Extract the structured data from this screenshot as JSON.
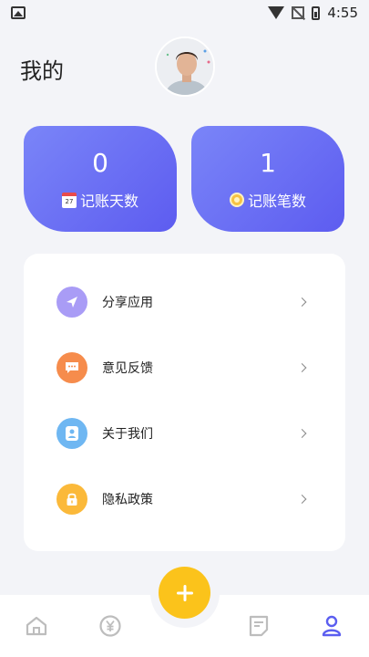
{
  "status_bar": {
    "time": "4:55",
    "icons": [
      "image-icon",
      "wifi-icon",
      "no-sim-icon",
      "battery-icon"
    ]
  },
  "header": {
    "title": "我的"
  },
  "stats": [
    {
      "value": "0",
      "label": "记账天数",
      "icon": "calendar-icon",
      "icon_text": "27"
    },
    {
      "value": "1",
      "label": "记账笔数",
      "icon": "coin-icon"
    }
  ],
  "menu": {
    "items": [
      {
        "label": "分享应用",
        "icon": "send-icon",
        "color": "#a99cf6"
      },
      {
        "label": "意见反馈",
        "icon": "chat-icon",
        "color": "#f68c4c"
      },
      {
        "label": "关于我们",
        "icon": "user-icon",
        "color": "#6fb7f2"
      },
      {
        "label": "隐私政策",
        "icon": "lock-icon",
        "color": "#fbb93a"
      }
    ]
  },
  "bottom_nav": {
    "items": [
      "home-icon",
      "yen-icon",
      "add-icon",
      "notes-icon",
      "profile-icon"
    ],
    "active": "profile-icon",
    "accent": "#5b5ef0",
    "fab_color": "#fbc31b"
  }
}
